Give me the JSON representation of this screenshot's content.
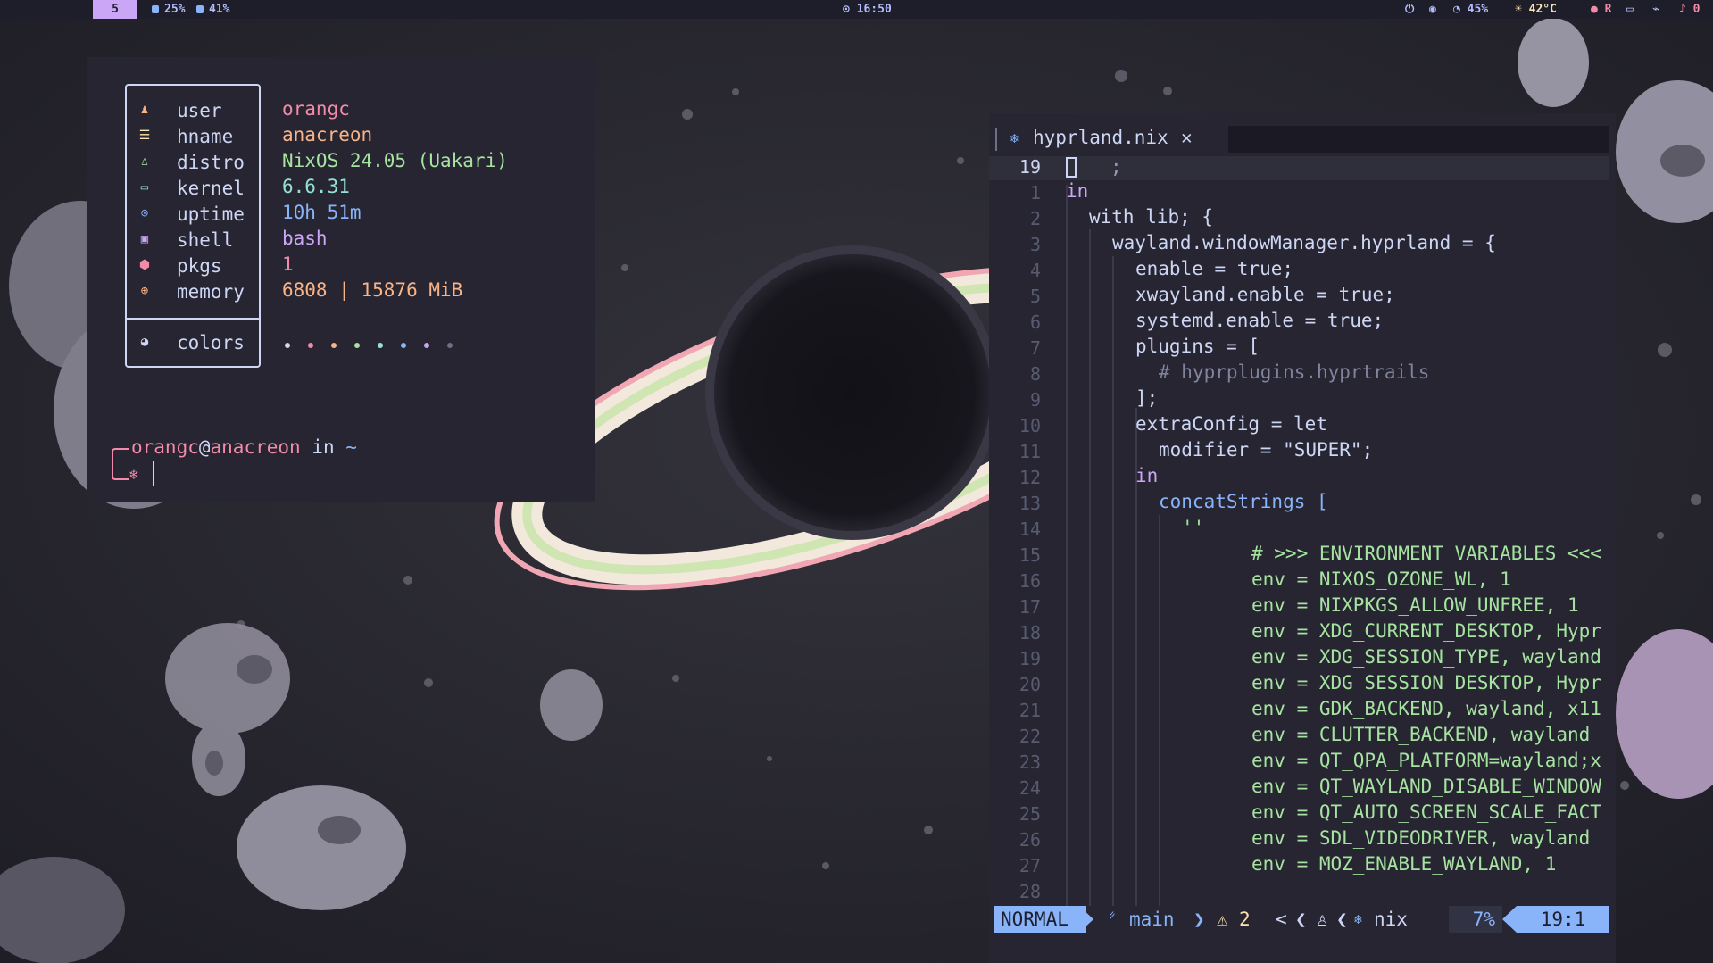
{
  "topbar": {
    "workspace": "5",
    "cpu": "25%",
    "ram": "41%",
    "clock": "16:50",
    "battery": "45%",
    "weather": "42°C",
    "record": "R",
    "notifications": "0"
  },
  "terminal": {
    "fetch": [
      {
        "icon": "user-icon",
        "label": "user",
        "value": "orangc"
      },
      {
        "icon": "hostname-icon",
        "label": "hname",
        "value": "anacreon"
      },
      {
        "icon": "distro-icon",
        "label": "distro",
        "value": "NixOS 24.05 (Uakari)"
      },
      {
        "icon": "kernel-icon",
        "label": "kernel",
        "value": "6.6.31"
      },
      {
        "icon": "uptime-icon",
        "label": "uptime",
        "value": "10h 51m"
      },
      {
        "icon": "shell-icon",
        "label": "shell",
        "value": "bash"
      },
      {
        "icon": "package-icon",
        "label": "pkgs",
        "value": "1"
      },
      {
        "icon": "memory-icon",
        "label": "memory",
        "value": "6808 | 15876 MiB"
      }
    ],
    "colors_label": "colors",
    "palette": [
      "#cdd6f4",
      "#f38ba8",
      "#fab387",
      "#a6e3a1",
      "#94e2d5",
      "#89b4fa",
      "#cba6f7",
      "#6c7086"
    ],
    "prompt_user": "orangc",
    "prompt_at": "@",
    "prompt_host": "anacreon",
    "prompt_in": " in ",
    "prompt_dir": "~"
  },
  "editor": {
    "tab_filename": "hyprland.nix",
    "current_line_number": "19",
    "current_line_text": ";",
    "lines": [
      {
        "n": "1",
        "text": "in"
      },
      {
        "n": "2",
        "text": "with lib; {"
      },
      {
        "n": "3",
        "text": "wayland.windowManager.hyprland = {"
      },
      {
        "n": "4",
        "text": "enable = true;"
      },
      {
        "n": "5",
        "text": "xwayland.enable = true;"
      },
      {
        "n": "6",
        "text": "systemd.enable = true;"
      },
      {
        "n": "7",
        "text": "plugins = ["
      },
      {
        "n": "8",
        "text": "# hyprplugins.hyprtrails"
      },
      {
        "n": "9",
        "text": "];"
      },
      {
        "n": "10",
        "text": "extraConfig = let"
      },
      {
        "n": "11",
        "text": "modifier = \"SUPER\";"
      },
      {
        "n": "12",
        "text": "in"
      },
      {
        "n": "13",
        "text": "concatStrings ["
      },
      {
        "n": "14",
        "text": "''"
      },
      {
        "n": "15",
        "text": "# >>> ENVIRONMENT VARIABLES <<<"
      },
      {
        "n": "16",
        "text": "env = NIXOS_OZONE_WL, 1"
      },
      {
        "n": "17",
        "text": "env = NIXPKGS_ALLOW_UNFREE, 1"
      },
      {
        "n": "18",
        "text": "env = XDG_CURRENT_DESKTOP, Hypr"
      },
      {
        "n": "19",
        "text": "env = XDG_SESSION_TYPE, wayland"
      },
      {
        "n": "20",
        "text": "env = XDG_SESSION_DESKTOP, Hypr"
      },
      {
        "n": "21",
        "text": "env = GDK_BACKEND, wayland, x11"
      },
      {
        "n": "22",
        "text": "env = CLUTTER_BACKEND, wayland"
      },
      {
        "n": "23",
        "text": "env = QT_QPA_PLATFORM=wayland;x"
      },
      {
        "n": "24",
        "text": "env = QT_WAYLAND_DISABLE_WINDOW"
      },
      {
        "n": "25",
        "text": "env = QT_AUTO_SCREEN_SCALE_FACT"
      },
      {
        "n": "26",
        "text": "env = SDL_VIDEODRIVER, wayland"
      },
      {
        "n": "27",
        "text": "env = MOZ_ENABLE_WAYLAND, 1"
      },
      {
        "n": "28",
        "text": ""
      }
    ],
    "status": {
      "mode": "NORMAL",
      "branch": "main",
      "warnings": "2",
      "filetype": "nix",
      "percent": "7%",
      "position": "19:1"
    }
  },
  "colors": {
    "accent": "#cba6f7",
    "keyword": "#f9b48d",
    "string": "#a6e3a1",
    "status_blue": "#89b4fa"
  }
}
